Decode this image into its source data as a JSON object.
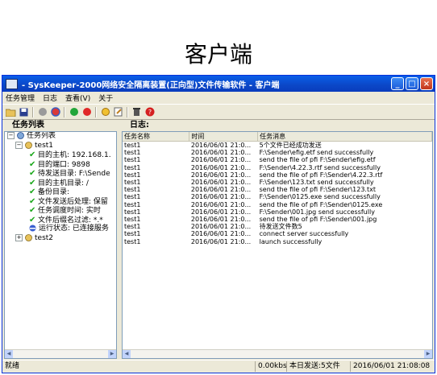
{
  "caption": "客户端",
  "window": {
    "title": "- SysKeeper-2000网络安全隔离装置(正向型)文件传输软件 - 客户端",
    "controls": [
      "_",
      "□",
      "×"
    ]
  },
  "menu": [
    "任务管理",
    "日志",
    "查看(V)",
    "关于"
  ],
  "toolbar_icons": [
    "open-folder-icon",
    "save-icon",
    "stop-icon",
    "pause-icon",
    "start-green-icon",
    "stop-red-icon",
    "settings-icon",
    "edit-icon",
    "delete-icon",
    "help-icon"
  ],
  "left_panel": {
    "header": "任务列表",
    "root": "任务列表",
    "task1": {
      "name": "test1",
      "items": [
        "目的主机: 192.168.1.",
        "目的端口: 9898",
        "待发送目录: F:\\Sende",
        "目的主机目录: /",
        "备份目录:",
        "文件发送后处理: 保留",
        "任务调度时间: 实时",
        "文件后缀名过滤: *.*",
        "运行状态: 已连接服务"
      ]
    },
    "task2": {
      "name": "test2"
    }
  },
  "right_panel": {
    "header": "日志:",
    "columns": [
      "任务名称",
      "时间",
      "任务消息"
    ],
    "rows": [
      [
        "test1",
        "2016/06/01 21:0...",
        "5个文件已经成功发送"
      ],
      [
        "test1",
        "2016/06/01 21:0...",
        "F:\\Sender\\efig.etf send successfully"
      ],
      [
        "test1",
        "2016/06/01 21:0...",
        "send the file of pfi F:\\Sender\\efig.etf"
      ],
      [
        "test1",
        "2016/06/01 21:0...",
        "F:\\Sender\\4.22.3.rtf send successfully"
      ],
      [
        "test1",
        "2016/06/01 21:0...",
        "send the file of pfi F:\\Sender\\4.22.3.rtf"
      ],
      [
        "test1",
        "2016/06/01 21:0...",
        "F:\\Sender\\123.txt send successfully"
      ],
      [
        "test1",
        "2016/06/01 21:0...",
        "send the file of pfi F:\\Sender\\123.txt"
      ],
      [
        "test1",
        "2016/06/01 21:0...",
        "F:\\Sender\\0125.exe send successfully"
      ],
      [
        "test1",
        "2016/06/01 21:0...",
        "send the file of pfi F:\\Sender\\0125.exe"
      ],
      [
        "test1",
        "2016/06/01 21:0...",
        "F:\\Sender\\001.jpg send successfully"
      ],
      [
        "test1",
        "2016/06/01 21:0...",
        "send the file of pfi F:\\Sender\\001.jpg"
      ],
      [
        "test1",
        "2016/06/01 21:0...",
        "待发送文件数5"
      ],
      [
        "test1",
        "2016/06/01 21:0...",
        "connect server successfully"
      ],
      [
        "test1",
        "2016/06/01 21:0...",
        "launch successfully"
      ]
    ]
  },
  "status": {
    "left": "就绪",
    "speed": "0.00kbs",
    "sent": "本日发送:5文件",
    "datetime": "2016/06/01 21:08:08"
  },
  "colors": {
    "titlebar": "#0b47c7",
    "frame": "#ece9d8",
    "check": "#1aa71a"
  }
}
